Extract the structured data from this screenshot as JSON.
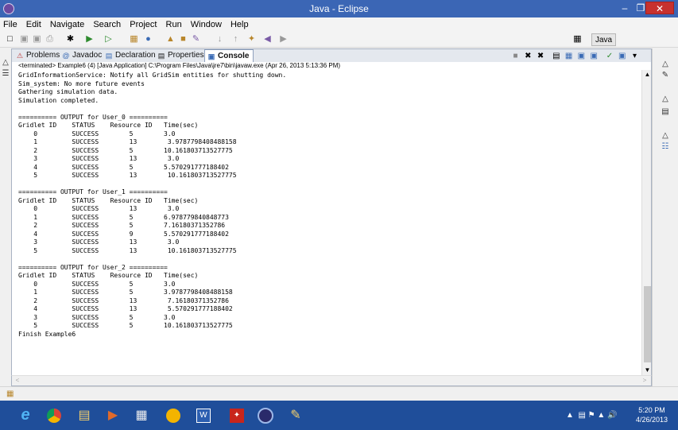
{
  "window": {
    "title": "Java - Eclipse"
  },
  "menu": [
    "File",
    "Edit",
    "Navigate",
    "Search",
    "Project",
    "Run",
    "Window",
    "Help"
  ],
  "perspective": {
    "label": "Java"
  },
  "tabs": [
    {
      "label": "Problems",
      "icon": "problems-icon"
    },
    {
      "label": "Javadoc",
      "icon": "javadoc-icon"
    },
    {
      "label": "Declaration",
      "icon": "declaration-icon"
    },
    {
      "label": "Properties",
      "icon": "properties-icon"
    },
    {
      "label": "Console",
      "icon": "console-icon",
      "close": "✕"
    }
  ],
  "console": {
    "header": "<terminated> Example6 (4) [Java Application] C:\\Program Files\\Java\\jre7\\bin\\javaw.exe (Apr 26, 2013 5:13:36 PM)",
    "lines": [
      "GridInformationService: Notify all GridSim entities for shutting down.",
      "Sim_system: No more future events",
      "Gathering simulation data.",
      "Simulation completed.",
      "",
      "========== OUTPUT for User_0 ==========",
      "Gridlet ID    STATUS    Resource ID   Time(sec)",
      "    0         SUCCESS        5        3.0",
      "    1         SUCCESS        13        3.9787798408488158",
      "    2         SUCCESS        5        10.161803713527775",
      "    3         SUCCESS        13        3.0",
      "    4         SUCCESS        5        5.570291777188402",
      "    5         SUCCESS        13        10.161803713527775",
      "",
      "========== OUTPUT for User_1 ==========",
      "Gridlet ID    STATUS    Resource ID   Time(sec)",
      "    0         SUCCESS        13        3.0",
      "    1         SUCCESS        5        6.978779840848773",
      "    2         SUCCESS        5        7.16180371352786",
      "    4         SUCCESS        9        5.570291777188402",
      "    3         SUCCESS        13        3.0",
      "    5         SUCCESS        13        10.161803713527775",
      "",
      "========== OUTPUT for User_2 ==========",
      "Gridlet ID    STATUS    Resource ID   Time(sec)",
      "    0         SUCCESS        5        3.0",
      "    1         SUCCESS        5        3.9787798408488158",
      "    2         SUCCESS        13        7.16180371352786",
      "    4         SUCCESS        13        5.570291777188402",
      "    3         SUCCESS        5        3.0",
      "    5         SUCCESS        5        10.161803713527775",
      "Finish Example6"
    ]
  },
  "taskbar": {
    "apps": [
      "ie-icon",
      "chrome-icon",
      "explorer-icon",
      "media-icon",
      "app-icon",
      "green-icon",
      "word-icon",
      "pdf-icon",
      "eclipse-icon",
      "paint-icon"
    ]
  },
  "clock": {
    "time": "5:20 PM",
    "date": "4/26/2013"
  },
  "colors": {
    "titlebar": "#3b66b5",
    "taskbar": "#1f4e9a",
    "close": "#c7312e"
  }
}
